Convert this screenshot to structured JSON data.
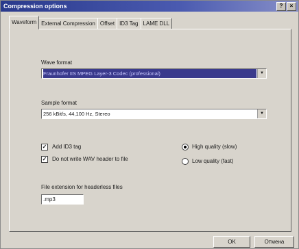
{
  "window": {
    "title": "Compression options",
    "title_buttons": [
      "?",
      "×"
    ]
  },
  "tabs": [
    {
      "label": "Waveform",
      "active": true
    },
    {
      "label": "External Compression",
      "active": false
    },
    {
      "label": "Offset",
      "active": false
    },
    {
      "label": "ID3 Tag",
      "active": false
    },
    {
      "label": "LAME DLL",
      "active": false
    }
  ],
  "wave_format": {
    "label": "Wave format",
    "value": "Fraunhofer IIS MPEG Layer-3 Codec (professional)"
  },
  "sample_format": {
    "label": "Sample format",
    "value": "256 kBit/s, 44,100 Hz, Stereo"
  },
  "options": {
    "add_id3_tag": {
      "label": "Add ID3 tag",
      "checked": true
    },
    "no_wav_header": {
      "label": "Do not write WAV header to file",
      "checked": true
    },
    "high_quality": {
      "label": "High quality (slow)",
      "selected": true
    },
    "low_quality": {
      "label": "Low quality (fast)",
      "selected": false
    }
  },
  "extension": {
    "label": "File extension for headerless files",
    "value": ".mp3"
  },
  "buttons": {
    "ok": "OK",
    "cancel": "Отмена"
  }
}
